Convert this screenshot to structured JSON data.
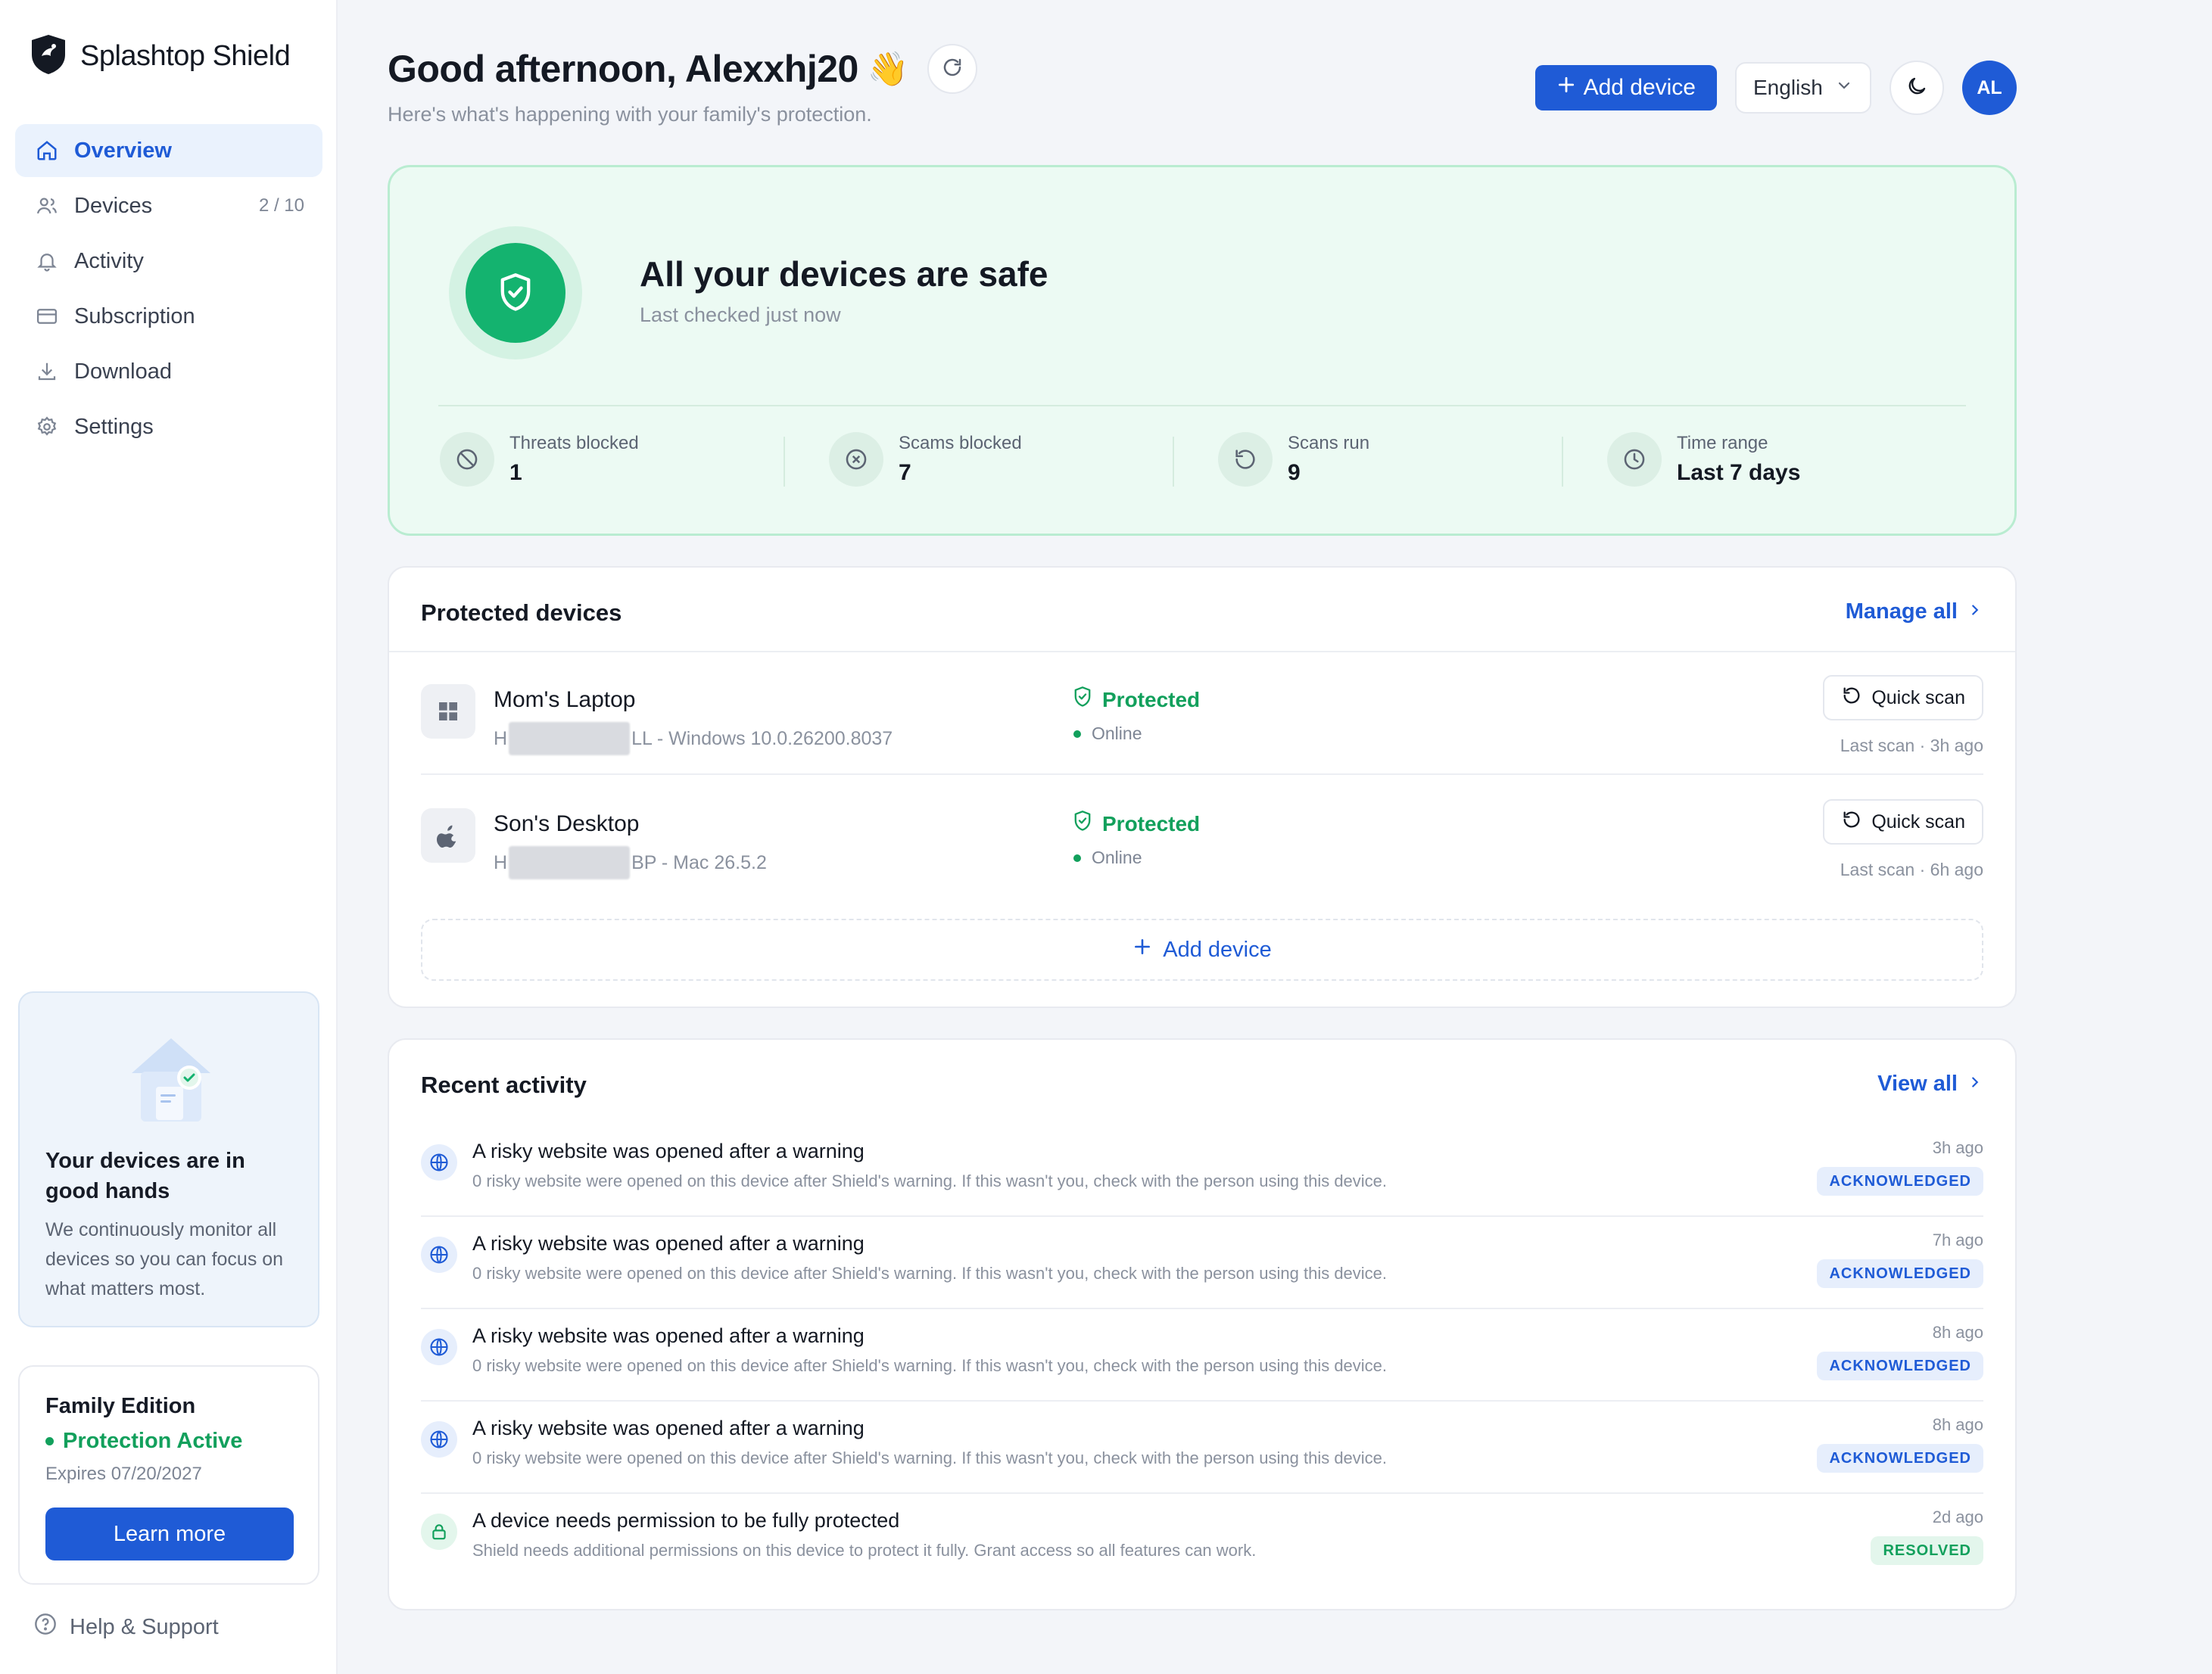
{
  "brand": {
    "name": "Splashtop Shield",
    "logo_icon": "shield-logo-icon"
  },
  "sidebar": {
    "items": [
      {
        "label": "Overview",
        "icon": "home-icon",
        "active": true,
        "count": ""
      },
      {
        "label": "Devices",
        "icon": "users-icon",
        "active": false,
        "count": "2 / 10"
      },
      {
        "label": "Activity",
        "icon": "bell-icon",
        "active": false,
        "count": ""
      },
      {
        "label": "Subscription",
        "icon": "card-icon",
        "active": false,
        "count": ""
      },
      {
        "label": "Download",
        "icon": "download-icon",
        "active": false,
        "count": ""
      },
      {
        "label": "Settings",
        "icon": "gear-icon",
        "active": false,
        "count": ""
      }
    ],
    "promo": {
      "title": "Your devices are in good hands",
      "text": "We continuously monitor all devices so you can focus on what matters most."
    },
    "plan": {
      "name": "Family Edition",
      "status": "Protection Active",
      "expires": "Expires 07/20/2027",
      "button": "Learn more"
    },
    "help": "Help & Support"
  },
  "header": {
    "greeting": "Good afternoon, Alexxhj20",
    "wave": "👋",
    "subtitle": "Here's what's happening with your family's protection.",
    "add_device": "Add device",
    "language": "English",
    "avatar": "AL"
  },
  "status_card": {
    "title": "All your devices are safe",
    "subtitle": "Last checked just now",
    "stats": [
      {
        "label": "Threats blocked",
        "value": "1",
        "icon": "block-icon"
      },
      {
        "label": "Scams blocked",
        "value": "7",
        "icon": "x-circle-icon"
      },
      {
        "label": "Scans run",
        "value": "9",
        "icon": "history-icon"
      },
      {
        "label": "Time range",
        "value": "Last 7 days",
        "icon": "clock-icon"
      }
    ]
  },
  "devices": {
    "title": "Protected devices",
    "manage_all": "Manage all",
    "add_device": "Add device",
    "rows": [
      {
        "name": "Mom's Laptop",
        "meta_prefix": "H",
        "meta_suffix": "LL - Windows 10.0.26200.8037",
        "os_icon": "windows-icon",
        "status": "Protected",
        "online": "Online",
        "scan_button": "Quick scan",
        "last_scan": "Last scan · 3h ago"
      },
      {
        "name": "Son's Desktop",
        "meta_prefix": "H",
        "meta_suffix": "BP - Mac 26.5.2",
        "os_icon": "apple-icon",
        "status": "Protected",
        "online": "Online",
        "scan_button": "Quick scan",
        "last_scan": "Last scan · 6h ago"
      }
    ]
  },
  "activity": {
    "title": "Recent activity",
    "view_all": "View all",
    "items": [
      {
        "title": "A risky website was opened after a warning",
        "desc": "0 risky website were opened on this device after Shield's warning. If this wasn't you, check with the person using this device.",
        "time": "3h ago",
        "badge": "ACKNOWLEDGED",
        "icon": "globe-icon"
      },
      {
        "title": "A risky website was opened after a warning",
        "desc": "0 risky website were opened on this device after Shield's warning. If this wasn't you, check with the person using this device.",
        "time": "7h ago",
        "badge": "ACKNOWLEDGED",
        "icon": "globe-icon"
      },
      {
        "title": "A risky website was opened after a warning",
        "desc": "0 risky website were opened on this device after Shield's warning. If this wasn't you, check with the person using this device.",
        "time": "8h ago",
        "badge": "ACKNOWLEDGED",
        "icon": "globe-icon"
      },
      {
        "title": "A risky website was opened after a warning",
        "desc": "0 risky website were opened on this device after Shield's warning. If this wasn't you, check with the person using this device.",
        "time": "8h ago",
        "badge": "ACKNOWLEDGED",
        "icon": "globe-icon"
      },
      {
        "title": "A device needs permission to be fully protected",
        "desc": "Shield needs additional permissions on this device to protect it fully. Grant access so all features can work.",
        "time": "2d ago",
        "badge": "RESOLVED",
        "icon": "lock-icon"
      }
    ]
  },
  "colors": {
    "accent": "#1f5bd6",
    "success": "#12a05c",
    "safe_bg": "#ecfaf3"
  }
}
